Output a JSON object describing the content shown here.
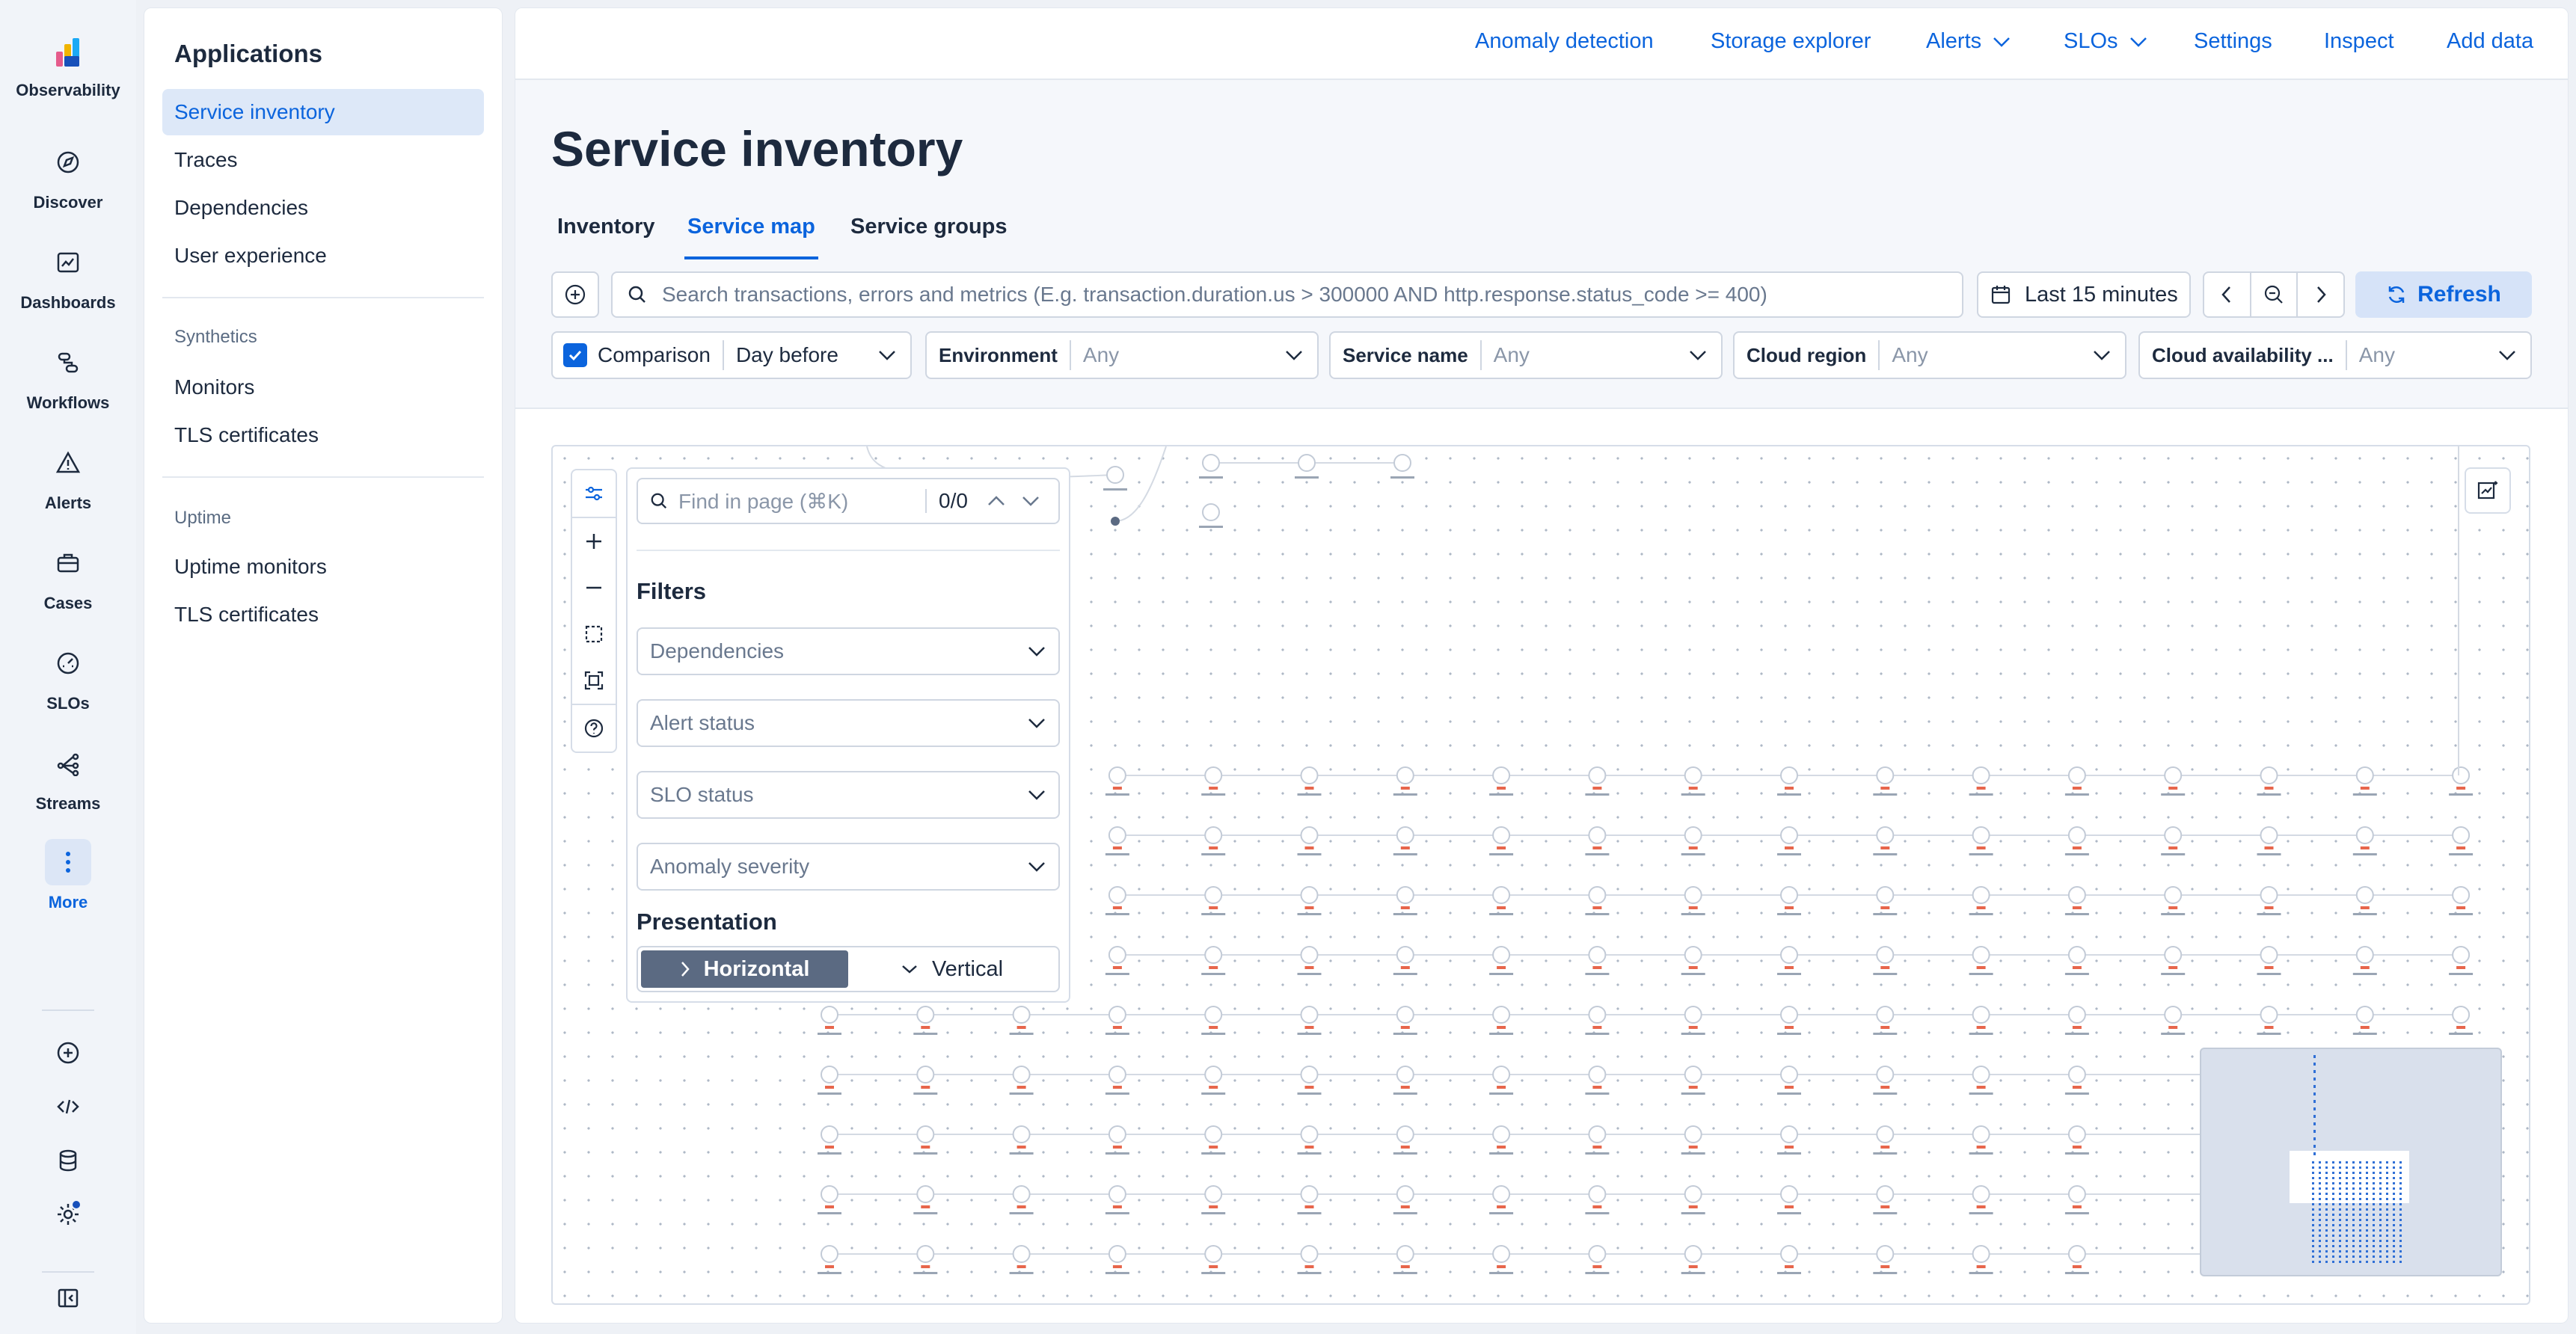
{
  "rail": {
    "items": [
      {
        "label": "Observability",
        "icon": "observability-logo-icon"
      },
      {
        "label": "Discover",
        "icon": "compass-icon"
      },
      {
        "label": "Dashboards",
        "icon": "dashboard-icon"
      },
      {
        "label": "Workflows",
        "icon": "workflow-icon"
      },
      {
        "label": "Alerts",
        "icon": "warning-triangle-icon"
      },
      {
        "label": "Cases",
        "icon": "briefcase-icon"
      },
      {
        "label": "SLOs",
        "icon": "gauge-icon"
      },
      {
        "label": "Streams",
        "icon": "streams-icon"
      },
      {
        "label": "More",
        "icon": "more-vertical-icon"
      }
    ],
    "bottom_icons": [
      "add-circle-icon",
      "code-icon",
      "database-icon",
      "gear-icon",
      "collapse-nav-icon"
    ]
  },
  "sidenav": {
    "title": "Applications",
    "items": [
      "Service inventory",
      "Traces",
      "Dependencies",
      "User experience"
    ],
    "synthetics": {
      "heading": "Synthetics",
      "items": [
        "Monitors",
        "TLS certificates"
      ]
    },
    "uptime": {
      "heading": "Uptime",
      "items": [
        "Uptime monitors",
        "TLS certificates"
      ]
    }
  },
  "topbar": {
    "links": [
      "Anomaly detection",
      "Storage explorer",
      "Alerts",
      "SLOs",
      "Settings",
      "Inspect",
      "Add data"
    ]
  },
  "page": {
    "title": "Service inventory",
    "tabs": [
      "Inventory",
      "Service map",
      "Service groups"
    ],
    "active_tab": "Service map"
  },
  "query": {
    "placeholder": "Search transactions, errors and metrics (E.g. transaction.duration.us > 300000 AND http.response.status_code >= 400)",
    "time_range": "Last 15 minutes",
    "refresh_label": "Refresh"
  },
  "filters": {
    "comparison_label": "Comparison",
    "comparison_checked": true,
    "comparison_value": "Day before",
    "environment": {
      "label": "Environment",
      "value": "Any"
    },
    "service_name": {
      "label": "Service name",
      "value": "Any"
    },
    "cloud_region": {
      "label": "Cloud region",
      "value": "Any"
    },
    "cloud_availability": {
      "label": "Cloud availability ...",
      "value": "Any"
    }
  },
  "map_panel": {
    "find_placeholder": "Find in page (⌘K)",
    "find_count": "0/0",
    "filters_heading": "Filters",
    "selects": [
      "Dependencies",
      "Alert status",
      "SLO status",
      "Anomaly severity"
    ],
    "presentation_heading": "Presentation",
    "presentation_options": [
      "Horizontal",
      "Vertical"
    ],
    "presentation_selected": "Horizontal"
  },
  "colors": {
    "accent": "#0b64dd",
    "node_alert": "#e7664c",
    "selected_toggle": "#5b6a82"
  }
}
